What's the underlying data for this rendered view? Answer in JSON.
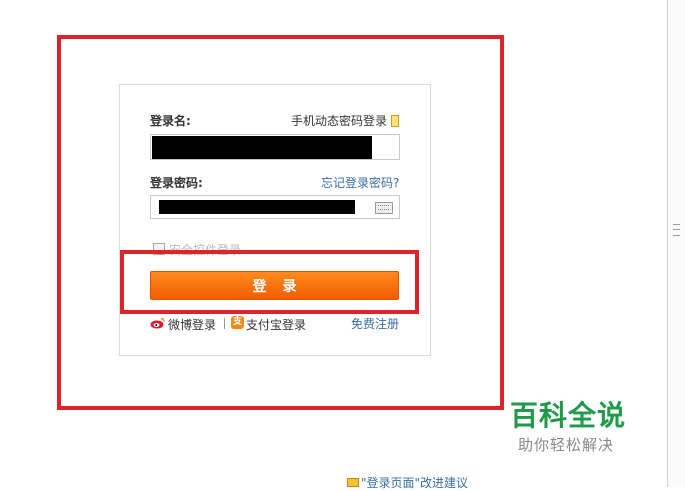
{
  "login": {
    "username_label": "登录名:",
    "phone_login_link": "手机动态密码登录",
    "password_label": "登录密码:",
    "forgot_link": "忘记登录密码?",
    "safe_control_label": "安全控件登录",
    "submit_label": "登录",
    "weibo_label": "微博登录",
    "alipay_label": "支付宝登录",
    "register_link": "免费注册",
    "alipay_glyph": "支"
  },
  "footer": {
    "feedback_link": "\"登录页面\"改进建议"
  },
  "watermark": {
    "title": "百科全说",
    "subtitle": "助你轻松解决"
  },
  "icons": {
    "phone": "phone-icon",
    "keyboard": "keyboard-icon",
    "weibo": "weibo-icon",
    "alipay": "alipay-icon",
    "feedback": "feedback-icon"
  },
  "colors": {
    "annotation_red": "#e0222b",
    "button_orange": "#f25d00",
    "link_blue": "#3a6ea5",
    "brand_green": "#1f9a48"
  }
}
